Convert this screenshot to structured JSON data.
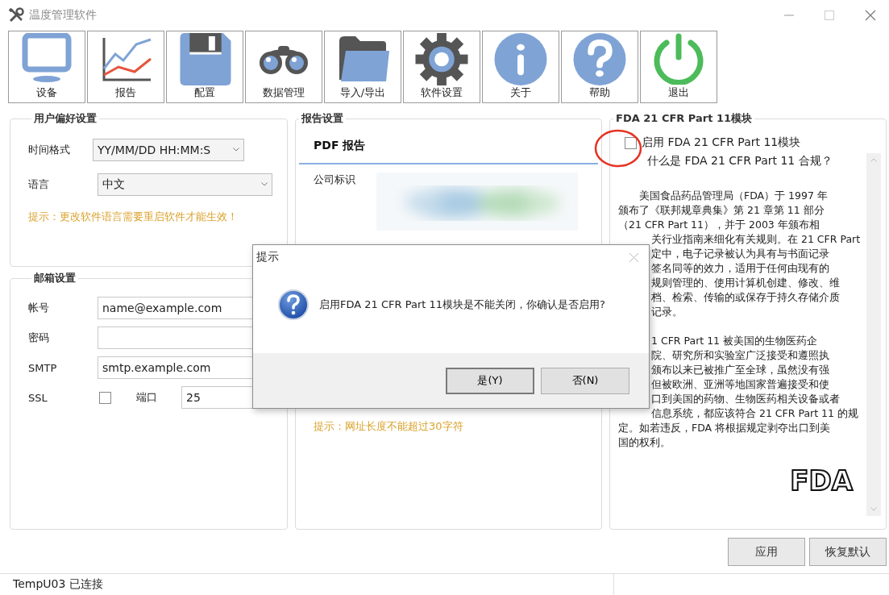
{
  "window": {
    "title": "温度管理软件"
  },
  "toolbar": [
    {
      "label": "设备",
      "kind": "monitor"
    },
    {
      "label": "报告",
      "kind": "chart"
    },
    {
      "label": "配置",
      "kind": "floppy"
    },
    {
      "label": "数据管理",
      "kind": "binoculars"
    },
    {
      "label": "导入/导出",
      "kind": "folder"
    },
    {
      "label": "软件设置",
      "kind": "gear"
    },
    {
      "label": "关于",
      "kind": "info"
    },
    {
      "label": "帮助",
      "kind": "help"
    },
    {
      "label": "退出",
      "kind": "power"
    }
  ],
  "preferences": {
    "title": "用户偏好设置",
    "fields": [
      {
        "label": "时间格式",
        "value": "YY/MM/DD HH:MM:S"
      },
      {
        "label": "语言",
        "value": "中文"
      }
    ],
    "hint": "提示：更改软件语言需要重启软件才能生效！"
  },
  "mail": {
    "title": "邮箱设置",
    "fields": [
      {
        "label": "帐号",
        "value": "name@example.com"
      },
      {
        "label": "密码"
      },
      {
        "label": "SMTP",
        "value": "smtp.example.com"
      }
    ],
    "ssl": {
      "label": "SSL",
      "checked": false
    },
    "port": {
      "label": "端口",
      "value": "25"
    }
  },
  "report": {
    "title": "报告设置",
    "tabs": [
      {
        "label": "PDF 报告",
        "selected": true
      }
    ],
    "logo_label": "公司标识",
    "hint": "提示：网址长度不能超过30字符"
  },
  "fda": {
    "title": "FDA 21 CFR Part 11模块",
    "enable": {
      "label": "启用 FDA 21 CFR Part 11模块",
      "checked": false
    },
    "question": "什么是 FDA 21 CFR Part 11 合规？",
    "paragraphs": [
      {
        "lines": [
          "美国食品药品管理局（FDA）于 1997 年",
          "颁布了《联邦规章典集》第 21 章第 11 部分",
          "（21 CFR Part 11），并于 2003 年颁布相",
          "关行业指南来细化有关规则。在 21 CFR Part",
          "定中，电子记录被认为具有与书面记录",
          "签名同等的效力，适用于任何由现有的",
          "规则管理的、使用计算机创建、修改、维",
          "档、检索、传输的或保存于持久存储介质",
          "记录。"
        ]
      },
      {
        "lines": [
          "1 CFR Part 11 被美国的生物医药企",
          "院、研究所和实验室广泛接受和遵照执",
          "颁布以来已被推广至全球，虽然没有强",
          "但被欧洲、亚洲等地国家普遍接受和使",
          "口到美国的药物、生物医药相关设备或者",
          "信息系统，都应该符合 21 CFR Part 11 的规",
          "定。如若违反，FDA 将根据规定剥夺出口到美",
          "国的权利。"
        ]
      }
    ],
    "logo": "FDA"
  },
  "buttons": [
    "应用",
    "恢复默认"
  ],
  "status_bar": {
    "text": "TempU03 已连接"
  },
  "dialog": {
    "title": "提示",
    "message": "启用FDA 21 CFR Part 11模块是不能关闭，你确认是否启用?",
    "buttons": [
      "是(Y)",
      "否(N)"
    ]
  }
}
